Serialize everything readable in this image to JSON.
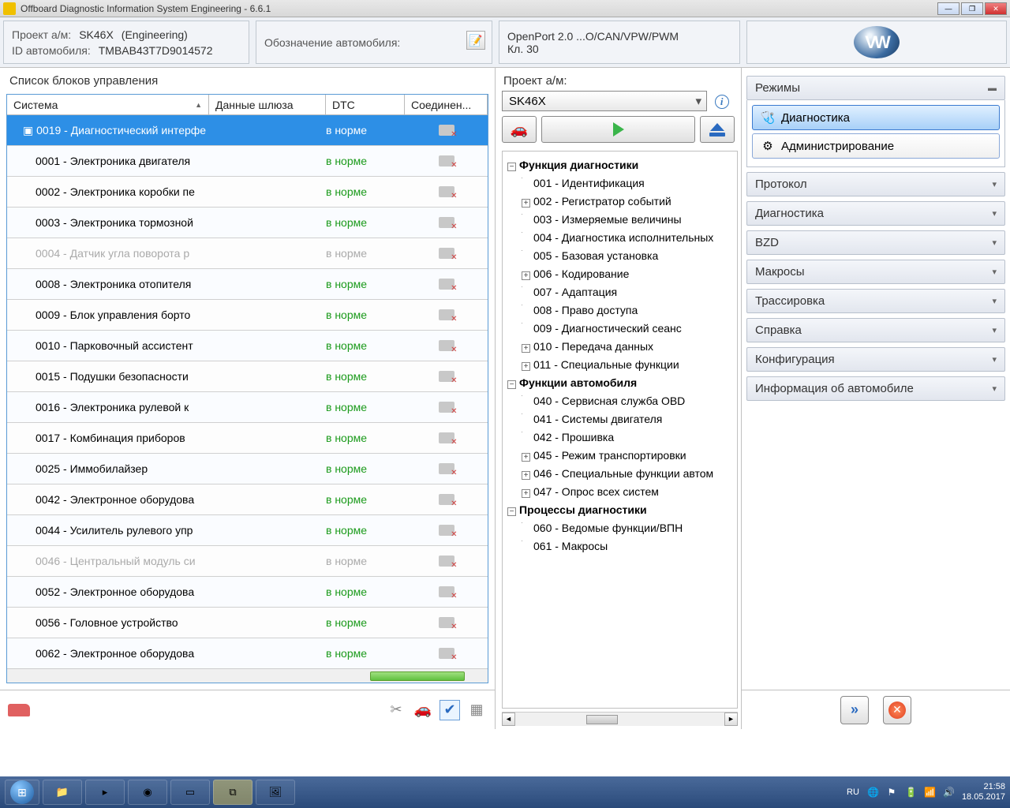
{
  "titlebar": {
    "title": "Offboard Diagnostic Information System Engineering - 6.6.1"
  },
  "header": {
    "project_label": "Проект а/м:",
    "project_value": "SK46X",
    "project_mode": "(Engineering)",
    "id_label": "ID автомобиля:",
    "id_value": "TMBAB43T7D9014572",
    "vehicle_desc_label": "Обозначение автомобиля:",
    "iface": "OpenPort 2.0 ...O/CAN/VPW/PWM",
    "kl": "Кл. 30"
  },
  "ecu_panel_title": "Список блоков управления",
  "ecu_cols": {
    "sys": "Система",
    "gw": "Данные шлюза",
    "dtc": "DTC",
    "conn": "Соединен..."
  },
  "ecu_rows": [
    {
      "sys": "0019 - Диагностический интерфе",
      "dtc": "в норме",
      "sel": true
    },
    {
      "sys": "0001 - Электроника двигателя",
      "dtc": "в норме"
    },
    {
      "sys": "0002 - Электроника коробки пе",
      "dtc": "в норме"
    },
    {
      "sys": "0003 - Электроника тормозной",
      "dtc": "в норме"
    },
    {
      "sys": "0004 - Датчик угла поворота р",
      "dtc": "в норме",
      "disabled": true
    },
    {
      "sys": "0008 - Электроника отопителя",
      "dtc": "в норме"
    },
    {
      "sys": "0009 - Блок управления борто",
      "dtc": "в норме"
    },
    {
      "sys": "0010 - Парковочный ассистент",
      "dtc": "в норме"
    },
    {
      "sys": "0015 - Подушки безопасности",
      "dtc": "в норме"
    },
    {
      "sys": "0016 - Электроника рулевой к",
      "dtc": "в норме"
    },
    {
      "sys": "0017 - Комбинация приборов",
      "dtc": "в норме"
    },
    {
      "sys": "0025 - Иммобилайзер",
      "dtc": "в норме"
    },
    {
      "sys": "0042 - Электронное оборудова",
      "dtc": "в норме"
    },
    {
      "sys": "0044 - Усилитель рулевого упр",
      "dtc": "в норме"
    },
    {
      "sys": "0046 - Центральный модуль си",
      "dtc": "в норме",
      "disabled": true
    },
    {
      "sys": "0052 - Электронное оборудова",
      "dtc": "в норме"
    },
    {
      "sys": "0056 - Головное устройство",
      "dtc": "в норме"
    },
    {
      "sys": "0062 - Электронное оборудова",
      "dtc": "в норме"
    }
  ],
  "mid": {
    "project_label": "Проект а/м:",
    "project_value": "SK46X"
  },
  "tree": {
    "g1": "Функция диагностики",
    "g1items": [
      "001 - Идентификация",
      "002 - Регистратор событий",
      "003 - Измеряемые величины",
      "004 - Диагностика исполнительных",
      "005 - Базовая установка",
      "006 - Кодирование",
      "007 - Адаптация",
      "008 - Право доступа",
      "009 - Диагностический сеанс",
      "010 - Передача данных",
      "011 - Специальные функции"
    ],
    "g1exp": [
      "",
      "+",
      "",
      "",
      "",
      "+",
      "",
      "",
      "",
      "+",
      "+"
    ],
    "g2": "Функции автомобиля",
    "g2items": [
      "040 - Сервисная служба OBD",
      "041 - Системы двигателя",
      "042 - Прошивка",
      "045 - Режим транспортировки",
      "046 - Специальные функции автом",
      "047 - Опрос всех систем"
    ],
    "g2exp": [
      "",
      "",
      "",
      "+",
      "+",
      "+"
    ],
    "g3": "Процессы диагностики",
    "g3items": [
      "060 - Ведомые функции/ВПН",
      "061 - Макросы"
    ]
  },
  "right": {
    "modes_title": "Режимы",
    "mode_diag": "Диагностика",
    "mode_admin": "Администрирование",
    "sections": [
      "Протокол",
      "Диагностика",
      "BZD",
      "Макросы",
      "Трассировка",
      "Справка",
      "Конфигурация",
      "Информация об автомобиле"
    ]
  },
  "tray": {
    "lang": "RU",
    "time": "21:58",
    "date": "18.05.2017"
  }
}
